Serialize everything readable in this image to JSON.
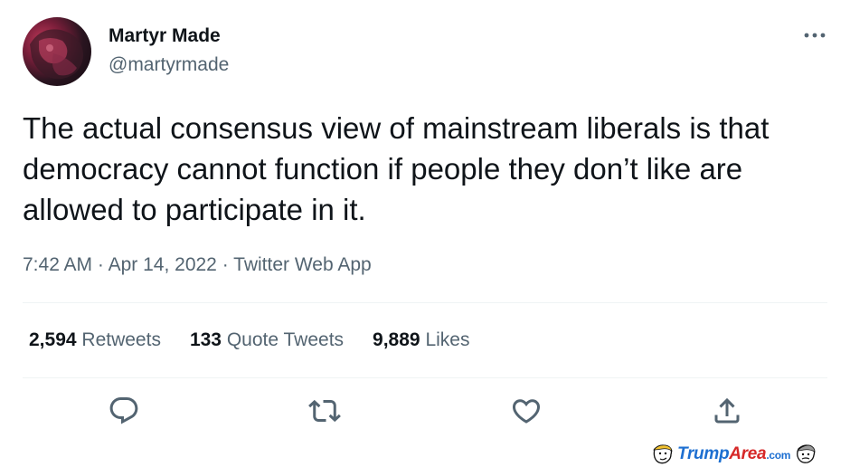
{
  "author": {
    "display_name": "Martyr Made",
    "handle": "@martyrmade",
    "avatar_icon": "profile-avatar"
  },
  "more_icon": "more-horizontal-icon",
  "tweet": {
    "text": "The actual consensus view of mainstream liberals is that democracy cannot function if people they don’t like are allowed to participate in it.",
    "time": "7:42 AM",
    "date": "Apr 14, 2022",
    "separator": "·",
    "source": "Twitter Web App"
  },
  "stats": {
    "retweets": {
      "count": "2,594",
      "label": "Retweets"
    },
    "quotes": {
      "count": "133",
      "label": "Quote Tweets"
    },
    "likes": {
      "count": "9,889",
      "label": "Likes"
    }
  },
  "actions": [
    {
      "icon": "reply-icon"
    },
    {
      "icon": "retweet-icon"
    },
    {
      "icon": "like-icon"
    },
    {
      "icon": "share-icon"
    }
  ],
  "watermark": {
    "part1": "Trump",
    "part2": "Area",
    "part3": ".com"
  },
  "colors": {
    "text_primary": "#0f1419",
    "text_secondary": "#536471",
    "divider": "#eff3f4",
    "watermark_blue": "#1d6fd1",
    "watermark_red": "#d62828"
  }
}
